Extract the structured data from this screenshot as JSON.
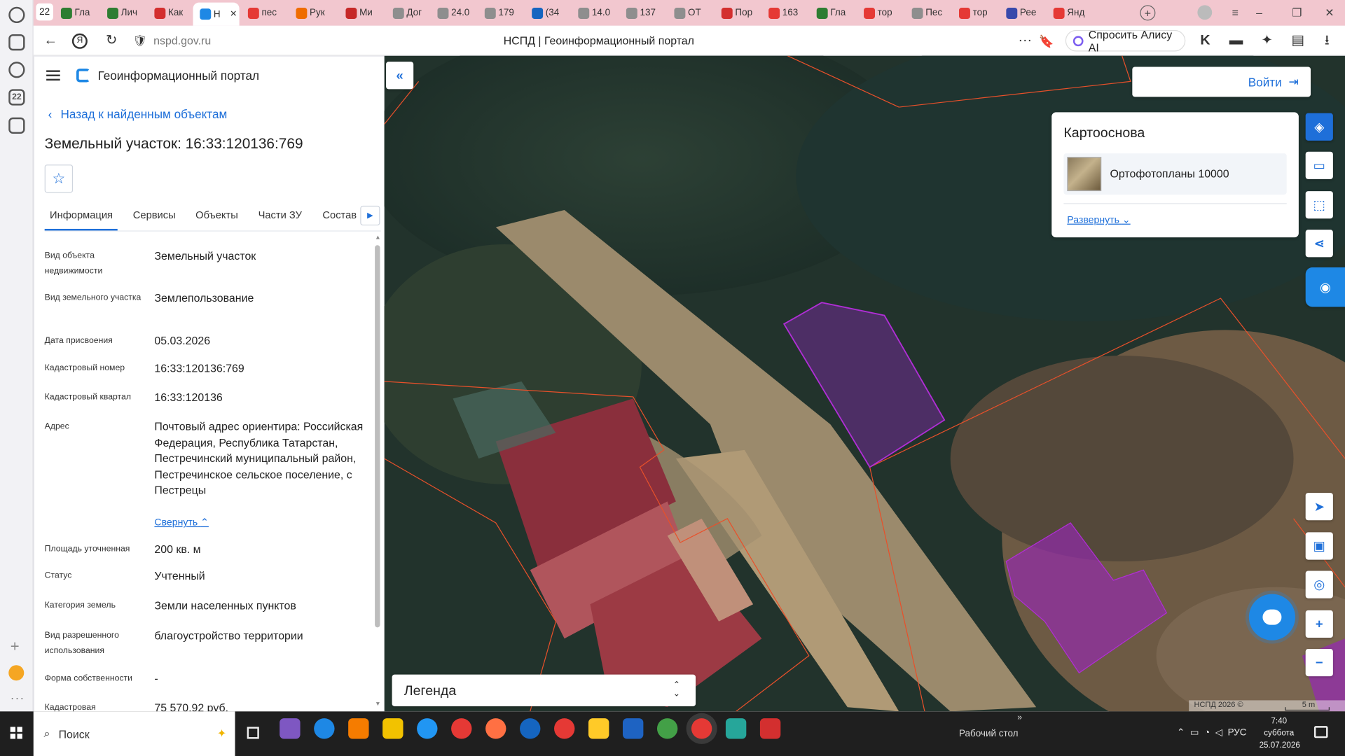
{
  "browser": {
    "tab_counter": "22",
    "tabs": [
      {
        "label": "Гла",
        "color": "#2e7d32"
      },
      {
        "label": "Лич",
        "color": "#2e7d32"
      },
      {
        "label": "Как",
        "color": "#d32f2f"
      },
      {
        "label": "Н",
        "color": "#1e88e5"
      },
      {
        "label": "пес",
        "color": "#e53935"
      },
      {
        "label": "Рук",
        "color": "#ef6c00"
      },
      {
        "label": "Ми",
        "color": "#c62828"
      },
      {
        "label": "Дог",
        "color": "#8e8e8e"
      },
      {
        "label": "24.0",
        "color": "#8e8e8e"
      },
      {
        "label": "179",
        "color": "#8e8e8e"
      },
      {
        "label": "(34",
        "color": "#1565c0"
      },
      {
        "label": "14.0",
        "color": "#8e8e8e"
      },
      {
        "label": "137",
        "color": "#8e8e8e"
      },
      {
        "label": "ОТ",
        "color": "#8e8e8e"
      },
      {
        "label": "Пор",
        "color": "#d32f2f"
      },
      {
        "label": "163",
        "color": "#e53935"
      },
      {
        "label": "Гла",
        "color": "#2e7d32"
      },
      {
        "label": "тор",
        "color": "#e53935"
      },
      {
        "label": "Пес",
        "color": "#8e8e8e"
      },
      {
        "label": "тор",
        "color": "#e53935"
      },
      {
        "label": "Рее",
        "color": "#3949ab"
      },
      {
        "label": "Янд",
        "color": "#e53935"
      }
    ],
    "url": "nspd.gov.ru",
    "page_title": "НСПД | Геоинформационный портал",
    "alice_label": "Спросить Алису AI"
  },
  "panel": {
    "portal_title": "Геоинформационный портал",
    "back_link": "Назад к найденным объектам",
    "object_title": "Земельный участок: 16:33:120136:769",
    "tabs": [
      "Информация",
      "Сервисы",
      "Объекты",
      "Части ЗУ",
      "Состав"
    ],
    "rows": [
      {
        "label": "Вид объекта недвижимости",
        "value": "Земельный участок"
      },
      {
        "label": "Вид земельного участка",
        "value": "Землепользование"
      },
      {
        "label": "Дата присвоения",
        "value": "05.03.2026"
      },
      {
        "label": "Кадастровый номер",
        "value": "16:33:120136:769"
      },
      {
        "label": "Кадастровый квартал",
        "value": "16:33:120136"
      },
      {
        "label": "Адрес",
        "value": "Почтовый адрес ориентира: Российская Федерация, Республика Татарстан, Пестречинский муниципальный район, Пестречинское сельское поселение, с Пестрецы"
      },
      {
        "label": "Площадь уточненная",
        "value": "200 кв. м"
      },
      {
        "label": "Статус",
        "value": "Учтенный"
      },
      {
        "label": "Категория земель",
        "value": "Земли населенных пунктов"
      },
      {
        "label": "Вид разрешенного использования",
        "value": "благоустройство территории"
      },
      {
        "label": "Форма собственности",
        "value": "-"
      },
      {
        "label": "Кадастровая",
        "value": "75 570,92 руб."
      }
    ],
    "collapse_link": "Свернуть"
  },
  "map": {
    "login_label": "Войти",
    "basemap_title": "Картооснова",
    "basemap_item": "Ортофотопланы 10000",
    "basemap_expand": "Развернуть",
    "legend_label": "Легенда",
    "attribution": "НСПД 2026 ©",
    "scale_label": "5 m",
    "colors": {
      "accent": "#1e6fd9",
      "parcel_line": "#e8502a",
      "parcel_selected": "#b02ed6"
    }
  },
  "taskbar": {
    "search_label": "Поиск",
    "desktop_label": "Рабочий стол",
    "lang": "РУС",
    "time": "7:40",
    "weekday": "суббота",
    "date": "25.07.2026"
  }
}
